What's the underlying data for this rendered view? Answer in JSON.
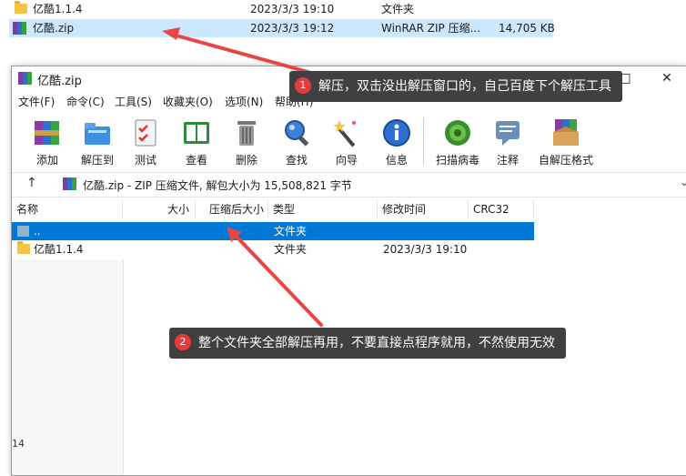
{
  "explorer": {
    "rows": [
      {
        "name": "亿酷1.1.4",
        "date": "2023/3/3 19:10",
        "type": "文件夹",
        "size": "",
        "icon": "folder-icon"
      },
      {
        "name": "亿酷.zip",
        "date": "2023/3/3 19:12",
        "type": "WinRAR ZIP 压缩...",
        "size": "14,705 KB",
        "icon": "winrar-zip-icon"
      }
    ]
  },
  "window": {
    "title": "亿酷.zip",
    "controls": {
      "minimize": "—",
      "maximize": "□",
      "close": "✕"
    },
    "menu": [
      "文件(F)",
      "命令(C)",
      "工具(S)",
      "收藏夹(O)",
      "选项(N)",
      "帮助(H)"
    ],
    "toolbar": [
      {
        "label": "添加",
        "icon": "add-archive-icon"
      },
      {
        "label": "解压到",
        "icon": "extract-to-icon"
      },
      {
        "label": "测试",
        "icon": "test-icon"
      },
      {
        "label": "查看",
        "icon": "view-icon"
      },
      {
        "label": "删除",
        "icon": "delete-icon"
      },
      {
        "label": "查找",
        "icon": "find-icon"
      },
      {
        "label": "向导",
        "icon": "wizard-icon"
      },
      {
        "label": "信息",
        "icon": "info-icon"
      },
      {
        "label": "扫描病毒",
        "icon": "virus-scan-icon"
      },
      {
        "label": "注释",
        "icon": "comment-icon"
      },
      {
        "label": "自解压格式",
        "icon": "sfx-icon"
      }
    ],
    "address": {
      "up_arrow": "↑",
      "path": "亿酷.zip - ZIP 压缩文件, 解包大小为 15,508,821 字节",
      "dropdown": "⌄"
    },
    "columns": [
      "名称",
      "大小",
      "压缩后大小",
      "类型",
      "修改时间",
      "CRC32"
    ],
    "files": [
      {
        "name": "..",
        "size": "",
        "packed": "",
        "type": "文件夹",
        "modified": "",
        "crc": "",
        "selected": true
      },
      {
        "name": "亿酷1.1.4",
        "size": "",
        "packed": "",
        "type": "文件夹",
        "modified": "2023/3/3 19:10",
        "crc": "",
        "selected": false
      }
    ],
    "leftpane_label": "14"
  },
  "annotations": [
    {
      "number": "1",
      "text": "解压，双击没出解压窗口的，自己百度下个解压工具"
    },
    {
      "number": "2",
      "text": "整个文件夹全部解压再用，不要直接点程序就用，不然使用无效"
    }
  ],
  "colors": {
    "selection": "#0078d7",
    "callout": "#404040",
    "badge": "#e83a3a",
    "arrow": "#e84545"
  }
}
